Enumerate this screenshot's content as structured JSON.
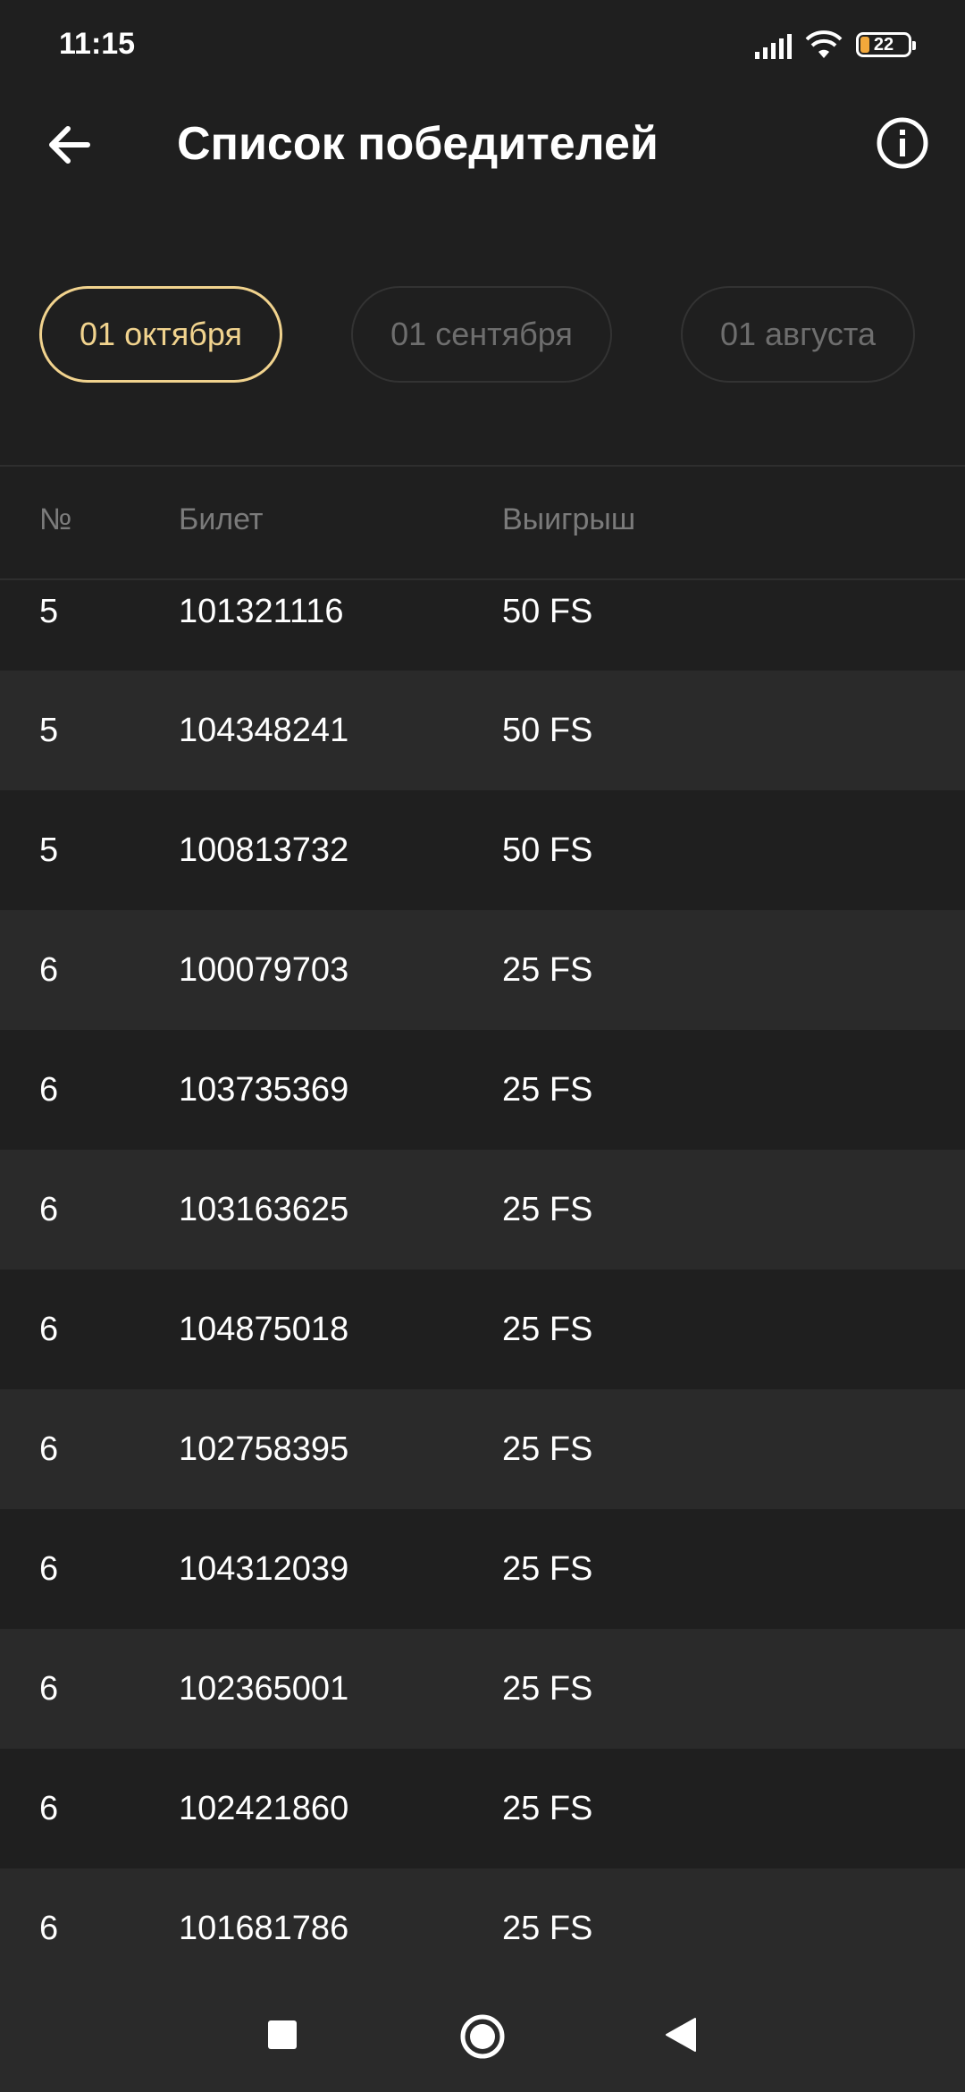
{
  "status": {
    "time": "11:15",
    "battery": "22",
    "battery_color": "#f2a83b"
  },
  "header": {
    "title": "Список победителей"
  },
  "tabs": [
    {
      "label": "01 октября",
      "active": true
    },
    {
      "label": "01 сентября",
      "active": false
    },
    {
      "label": "01 августа",
      "active": false
    }
  ],
  "table": {
    "columns": [
      "№",
      "Билет",
      "Выигрыш"
    ],
    "rows": [
      {
        "place": "5",
        "ticket": "101321116",
        "prize": "50 FS"
      },
      {
        "place": "5",
        "ticket": "104348241",
        "prize": "50 FS"
      },
      {
        "place": "5",
        "ticket": "100813732",
        "prize": "50 FS"
      },
      {
        "place": "6",
        "ticket": "100079703",
        "prize": "25 FS"
      },
      {
        "place": "6",
        "ticket": "103735369",
        "prize": "25 FS"
      },
      {
        "place": "6",
        "ticket": "103163625",
        "prize": "25 FS"
      },
      {
        "place": "6",
        "ticket": "104875018",
        "prize": "25 FS"
      },
      {
        "place": "6",
        "ticket": "102758395",
        "prize": "25 FS"
      },
      {
        "place": "6",
        "ticket": "104312039",
        "prize": "25 FS"
      },
      {
        "place": "6",
        "ticket": "102365001",
        "prize": "25 FS"
      },
      {
        "place": "6",
        "ticket": "102421860",
        "prize": "25 FS"
      },
      {
        "place": "6",
        "ticket": "101681786",
        "prize": "25 FS"
      }
    ]
  },
  "colors": {
    "accent": "#f1d38e",
    "background": "#1f1f1f",
    "row_alt": "#2a2a2a"
  }
}
